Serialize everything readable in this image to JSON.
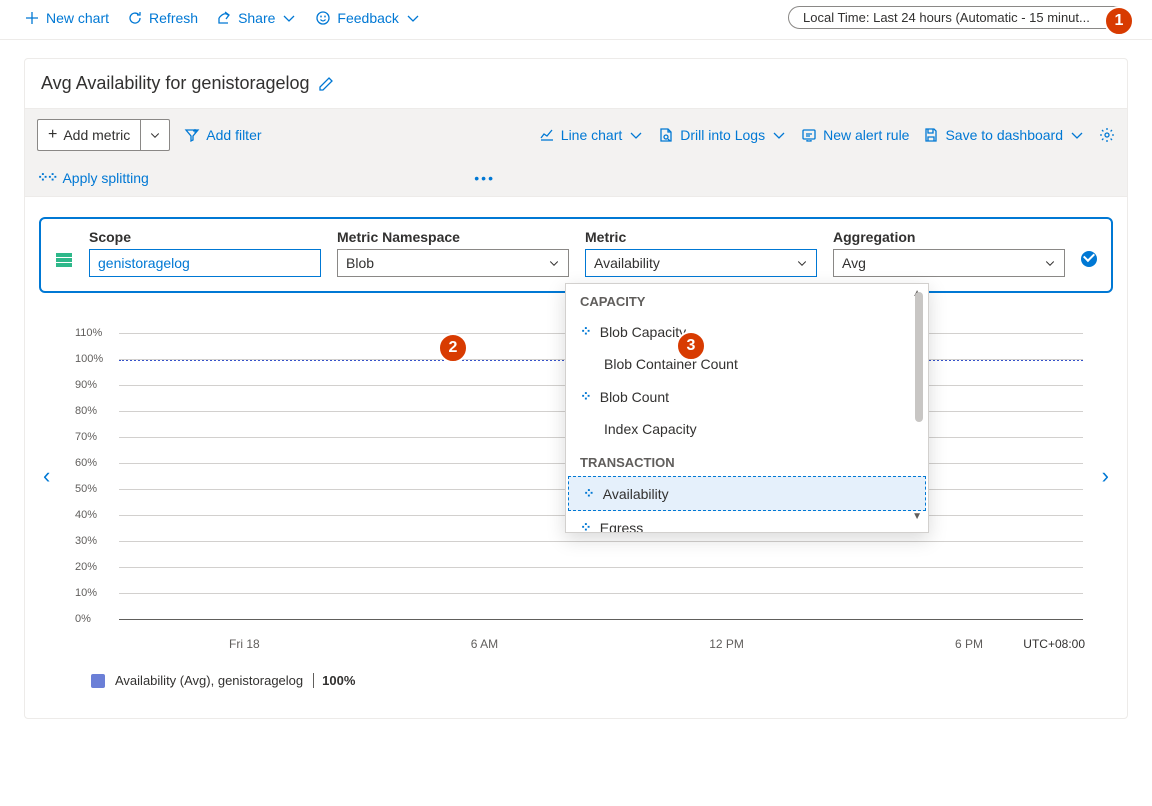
{
  "topbar": {
    "new_chart": "New chart",
    "refresh": "Refresh",
    "share": "Share",
    "feedback": "Feedback",
    "time_pill": "Local Time: Last 24 hours (Automatic - 15 minut..."
  },
  "callouts": {
    "c1": "1",
    "c2": "2",
    "c3": "3"
  },
  "card": {
    "title": "Avg Availability for genistoragelog",
    "add_metric": "Add metric",
    "add_filter": "Add filter",
    "apply_splitting": "Apply splitting",
    "line_chart": "Line chart",
    "drill_logs": "Drill into Logs",
    "new_alert": "New alert rule",
    "save_dash": "Save to dashboard"
  },
  "metric": {
    "scope_label": "Scope",
    "scope_value": "genistoragelog",
    "ns_label": "Metric Namespace",
    "ns_value": "Blob",
    "metric_label": "Metric",
    "metric_value": "Availability",
    "agg_label": "Aggregation",
    "agg_value": "Avg"
  },
  "dropdown": {
    "capacity_header": "CAPACITY",
    "items_cap": [
      "Blob Capacity",
      "Blob Container Count",
      "Blob Count",
      "Index Capacity"
    ],
    "transaction_header": "TRANSACTION",
    "items_trans": [
      "Availability",
      "Egress"
    ]
  },
  "chart_data": {
    "type": "line",
    "title": "Avg Availability for genistoragelog",
    "ylabel": "",
    "ylim": [
      0,
      110
    ],
    "y_ticks": [
      "110%",
      "100%",
      "90%",
      "80%",
      "70%",
      "60%",
      "50%",
      "40%",
      "30%",
      "20%",
      "10%",
      "0%"
    ],
    "x_ticks": [
      "Fri 18",
      "6 AM",
      "12 PM",
      "6 PM"
    ],
    "timezone": "UTC+08:00",
    "series": [
      {
        "name": "Availability (Avg), genistoragelog",
        "value_label": "100%",
        "constant_value": 100
      }
    ]
  }
}
